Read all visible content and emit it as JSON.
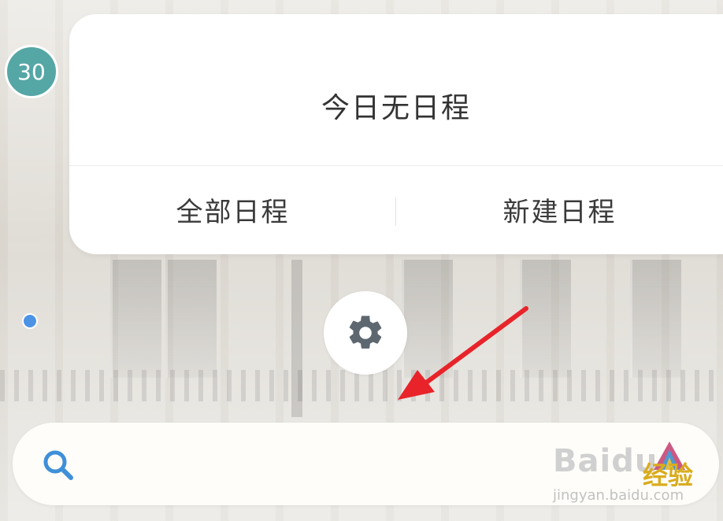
{
  "calendar": {
    "date_badge": "30"
  },
  "schedule_card": {
    "title": "今日无日程",
    "all_schedules_label": "全部日程",
    "new_schedule_label": "新建日程"
  },
  "settings": {
    "icon": "gear-icon"
  },
  "search": {
    "icon": "search-icon",
    "value": "",
    "placeholder": ""
  },
  "watermark": {
    "logo_text": "Baidu",
    "jingyan_text": "经验",
    "url": "jingyan.baidu.com"
  },
  "annotation": {
    "arrow_color": "#e8232a"
  },
  "colors": {
    "date_badge": "#55a7a6",
    "timeline_dot": "#4c93e6",
    "search_icon": "#3f8fd9",
    "gear_icon": "#5d6770"
  }
}
